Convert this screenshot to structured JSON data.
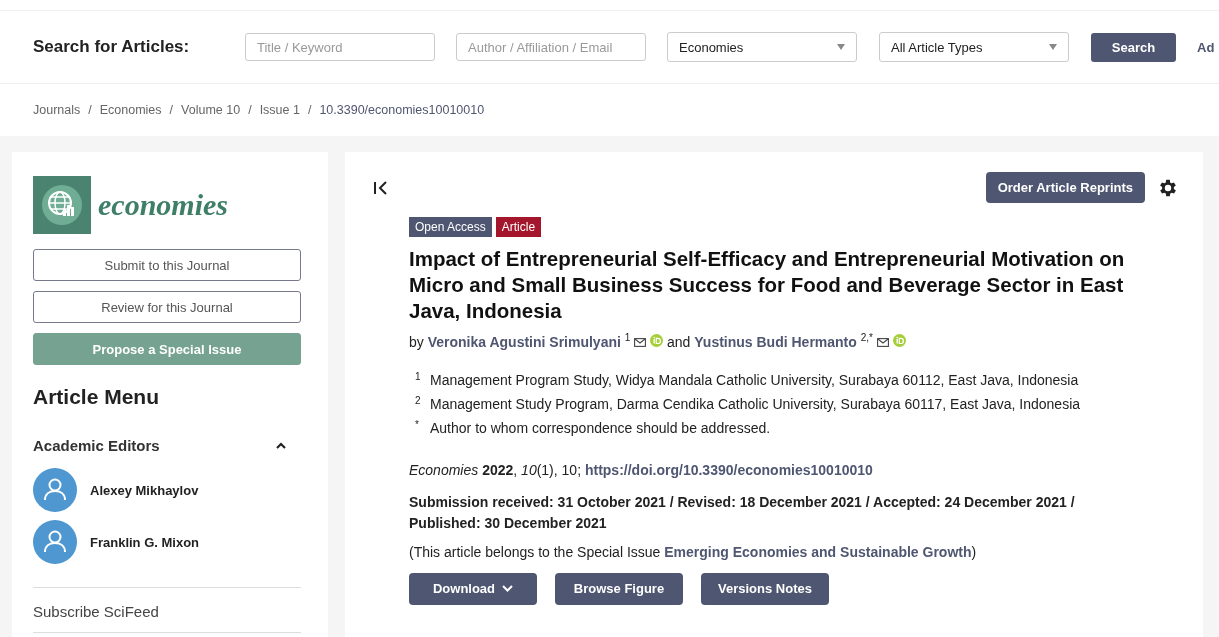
{
  "search": {
    "label": "Search for Articles:",
    "fields": [
      {
        "placeholder": "Title / Keyword"
      },
      {
        "placeholder": "Author / Affiliation / Email"
      }
    ],
    "selects": [
      {
        "value": "Economies"
      },
      {
        "value": "All Article Types"
      }
    ],
    "button": "Search",
    "cut_link": "Ad"
  },
  "breadcrumb_separator": "/",
  "breadcrumb": [
    "Journals",
    "Economies",
    "Volume 10",
    "Issue 1",
    "10.3390/economies10010010"
  ],
  "sidebar": {
    "journal_name": "economies",
    "buttons": [
      {
        "label": "Submit to this Journal",
        "kind": "outline"
      },
      {
        "label": "Review for this Journal",
        "kind": "outline"
      },
      {
        "label": "Propose a Special Issue",
        "kind": "filled"
      }
    ],
    "menu_title": "Article Menu",
    "section": {
      "title": "Academic Editors",
      "expanded": true
    },
    "editors": [
      "Alexey Mikhaylov",
      "Franklin G. Mixon"
    ],
    "links": [
      "Subscribe SciFeed"
    ]
  },
  "article": {
    "order_button": "Order Article Reprints",
    "badges": [
      {
        "label": "Open Access",
        "kind": "access"
      },
      {
        "label": "Article",
        "kind": "type"
      }
    ],
    "title": "Impact of Entrepreneurial Self-Efficacy and Entrepreneurial Motivation on Micro and Small Business Success for Food and Beverage Sector in East Java, Indonesia",
    "by": "by",
    "connector": "and",
    "authors": [
      {
        "name": "Veronika Agustini Srimulyani",
        "mark": "1"
      },
      {
        "name": "Yustinus Budi Hermanto",
        "mark": "2,*"
      }
    ],
    "affiliations": [
      {
        "mark": "1",
        "text": "Management Program Study, Widya Mandala Catholic University, Surabaya 60112, East Java, Indonesia"
      },
      {
        "mark": "2",
        "text": "Management Study Program, Darma Cendika Catholic University, Surabaya 60117, East Java, Indonesia"
      },
      {
        "mark": "*",
        "text": "Author to whom correspondence should be addressed."
      }
    ],
    "citation": {
      "prefix": "*Economies* **2022**, *10*(1), 10;",
      "doi": "https://doi.org/10.3390/economies10010010"
    },
    "dates": "Submission received: 31 October 2021 / Revised: 18 December 2021 / Accepted: 24 December 2021 / Published: 30 December 2021",
    "special_issue": {
      "prefix": "(This article belongs to the Special Issue",
      "name": "Emerging Economies and Sustainable Growth",
      "suffix": ")"
    },
    "buttons": [
      {
        "label": "Download",
        "dropdown": true
      },
      {
        "label": "Browse Figure",
        "dropdown": false
      },
      {
        "label": "Versions Notes",
        "dropdown": false
      }
    ]
  }
}
